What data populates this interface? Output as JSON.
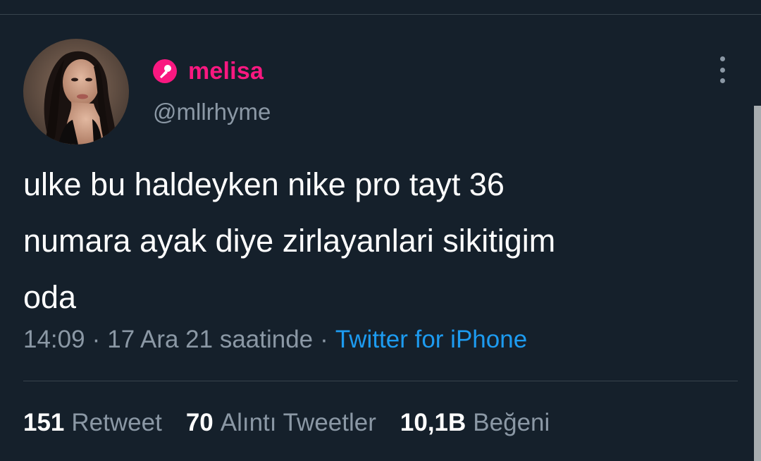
{
  "colors": {
    "background": "#15202b",
    "name": "#f91880",
    "secondary_text": "#8b98a5",
    "link": "#1d9bf0",
    "divider": "#38444d"
  },
  "author": {
    "display_name": "melisa",
    "handle": "@mllrhyme",
    "badge_icon": "microphone-icon"
  },
  "tweet": {
    "text_lines": [
      "ulke bu haldeyken nike pro tayt 36",
      "numara ayak diye zirlayanlari sikitigim",
      "oda"
    ]
  },
  "meta": {
    "time": "14:09",
    "separator": "·",
    "date": "17 Ara 21 saatinde",
    "source": "Twitter for iPhone"
  },
  "stats": {
    "retweets": {
      "count": "151",
      "label": "Retweet"
    },
    "quotes": {
      "count": "70",
      "label": "Alıntı Tweetler"
    },
    "likes": {
      "count": "10,1B",
      "label": "Beğeni"
    }
  },
  "menu_icon": "more-vertical-icon"
}
